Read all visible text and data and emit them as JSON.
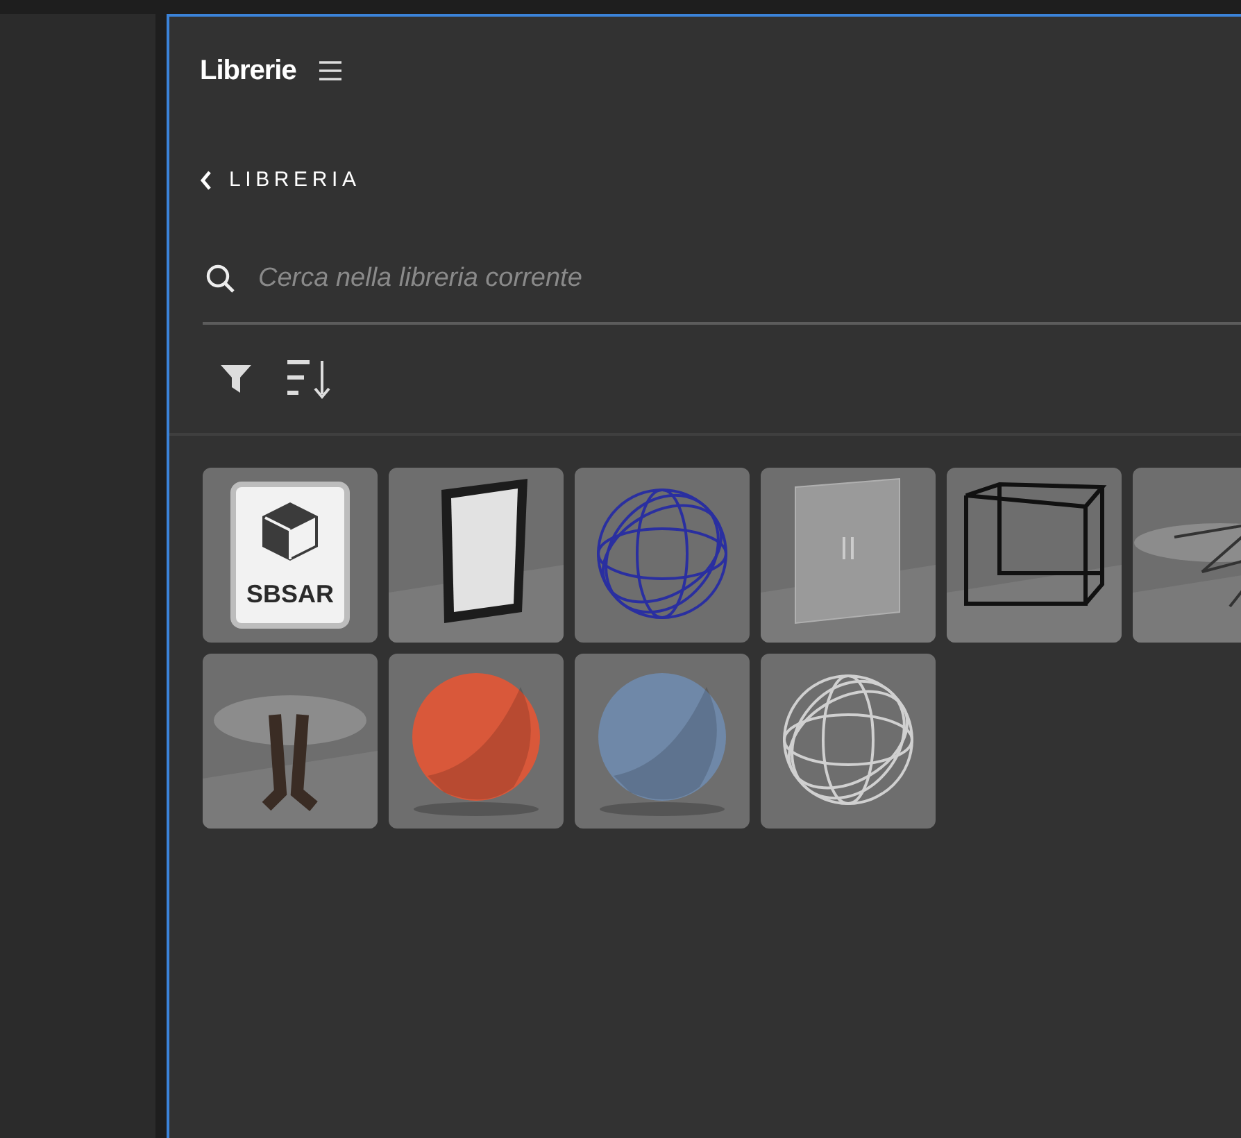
{
  "panel": {
    "title": "Librerie"
  },
  "breadcrumb": {
    "label": "LIBRERIA"
  },
  "search": {
    "placeholder": "Cerca nella libreria corrente"
  },
  "items": [
    {
      "kind": "sbsar",
      "label": "SBSAR"
    },
    {
      "kind": "frame"
    },
    {
      "kind": "wire-sphere",
      "color": "#2a2fa0"
    },
    {
      "kind": "glass-door"
    },
    {
      "kind": "cube"
    },
    {
      "kind": "table-wire"
    },
    {
      "kind": "table"
    },
    {
      "kind": "fabric-sphere",
      "color": "#d9583a"
    },
    {
      "kind": "fabric-sphere",
      "color": "#6f88a8"
    },
    {
      "kind": "wire-sphere",
      "color": "#d0d0d0"
    }
  ]
}
